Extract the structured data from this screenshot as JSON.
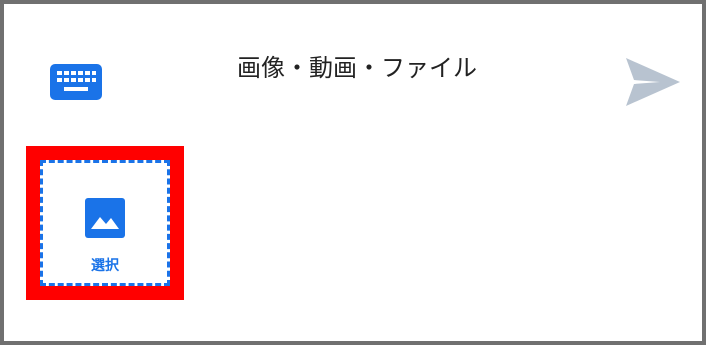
{
  "header": {
    "title": "画像・動画・ファイル",
    "keyboard_icon": "keyboard-icon",
    "send_icon": "send-icon"
  },
  "attachment": {
    "select_label": "選択",
    "icon": "image-icon"
  },
  "colors": {
    "accent": "#1a73e8",
    "send_disabled": "#b8c3d0",
    "highlight": "#ff0000",
    "frame_border": "#707070"
  }
}
